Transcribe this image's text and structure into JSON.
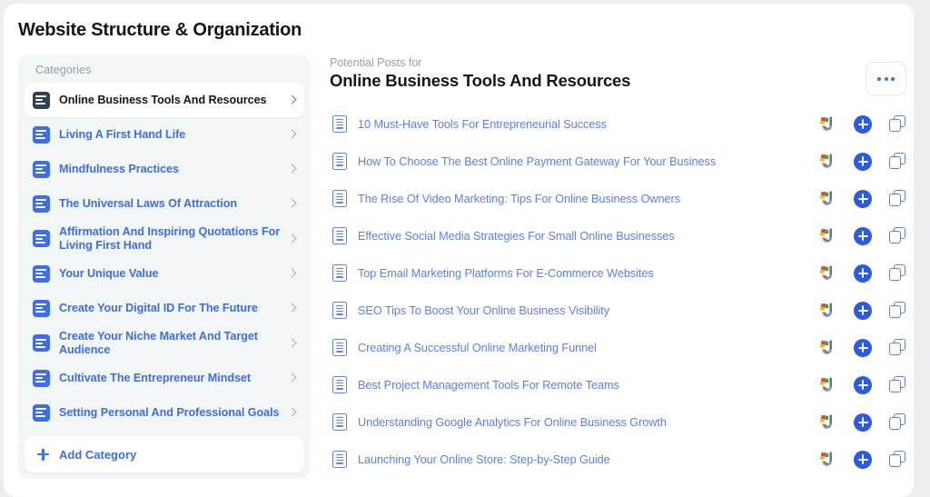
{
  "page": {
    "title": "Website Structure & Organization"
  },
  "sidebar": {
    "label": "Categories",
    "add_button": {
      "label": "Add Category",
      "icon": "plus-icon"
    },
    "items": [
      {
        "label": "Online Business Tools And Resources",
        "selected": true,
        "icon": "category-icon",
        "chevron": "chevron-right-icon"
      },
      {
        "label": "Living A First Hand Life",
        "selected": false,
        "icon": "category-icon",
        "chevron": "chevron-right-icon"
      },
      {
        "label": "Mindfulness Practices",
        "selected": false,
        "icon": "category-icon",
        "chevron": "chevron-right-icon"
      },
      {
        "label": "The Universal Laws Of Attraction",
        "selected": false,
        "icon": "category-icon",
        "chevron": "chevron-right-icon"
      },
      {
        "label": "Affirmation And Inspiring Quotations For Living First Hand",
        "selected": false,
        "icon": "category-icon",
        "chevron": "chevron-right-icon"
      },
      {
        "label": "Your Unique Value",
        "selected": false,
        "icon": "category-icon",
        "chevron": "chevron-right-icon"
      },
      {
        "label": "Create Your Digital ID For The Future",
        "selected": false,
        "icon": "category-icon",
        "chevron": "chevron-right-icon"
      },
      {
        "label": "Create Your Niche Market And Target Audience",
        "selected": false,
        "icon": "category-icon",
        "chevron": "chevron-right-icon"
      },
      {
        "label": "Cultivate The Entrepreneur Mindset",
        "selected": false,
        "icon": "category-icon",
        "chevron": "chevron-right-icon"
      },
      {
        "label": "Setting Personal And Professional Goals",
        "selected": false,
        "icon": "category-icon",
        "chevron": "chevron-right-icon"
      }
    ]
  },
  "main": {
    "eyebrow": "Potential Posts for",
    "title": "Online Business Tools And Resources",
    "more_menu": {
      "icon": "ellipsis-icon",
      "label": "..."
    },
    "row_actions": [
      {
        "icon": "jasper-brand-icon"
      },
      {
        "icon": "add-circle-icon"
      },
      {
        "icon": "copy-icon"
      }
    ],
    "posts": [
      {
        "title": "10 Must-Have Tools For Entrepreneurial Success",
        "icon": "document-icon"
      },
      {
        "title": "How To Choose The Best Online Payment Gateway For Your Business",
        "icon": "document-icon"
      },
      {
        "title": "The Rise Of Video Marketing: Tips For Online Business Owners",
        "icon": "document-icon"
      },
      {
        "title": "Effective Social Media Strategies For Small Online Businesses",
        "icon": "document-icon"
      },
      {
        "title": "Top Email Marketing Platforms For E-Commerce Websites",
        "icon": "document-icon"
      },
      {
        "title": "SEO Tips To Boost Your Online Business Visibility",
        "icon": "document-icon"
      },
      {
        "title": "Creating A Successful Online Marketing Funnel",
        "icon": "document-icon"
      },
      {
        "title": "Best Project Management Tools For Remote Teams",
        "icon": "document-icon"
      },
      {
        "title": "Understanding Google Analytics For Online Business Growth",
        "icon": "document-icon"
      },
      {
        "title": "Launching Your Online Store: Step-by-Step Guide",
        "icon": "document-icon"
      }
    ]
  },
  "colors": {
    "accent_blue": "#3d6cf0",
    "link_blue": "#5b7ff0",
    "title_dark": "#14161a",
    "muted": "#93a0ad",
    "sidebar_bg": "#f2f6f7",
    "page_bg": "#eceef0",
    "selected_icon": "#344055"
  }
}
